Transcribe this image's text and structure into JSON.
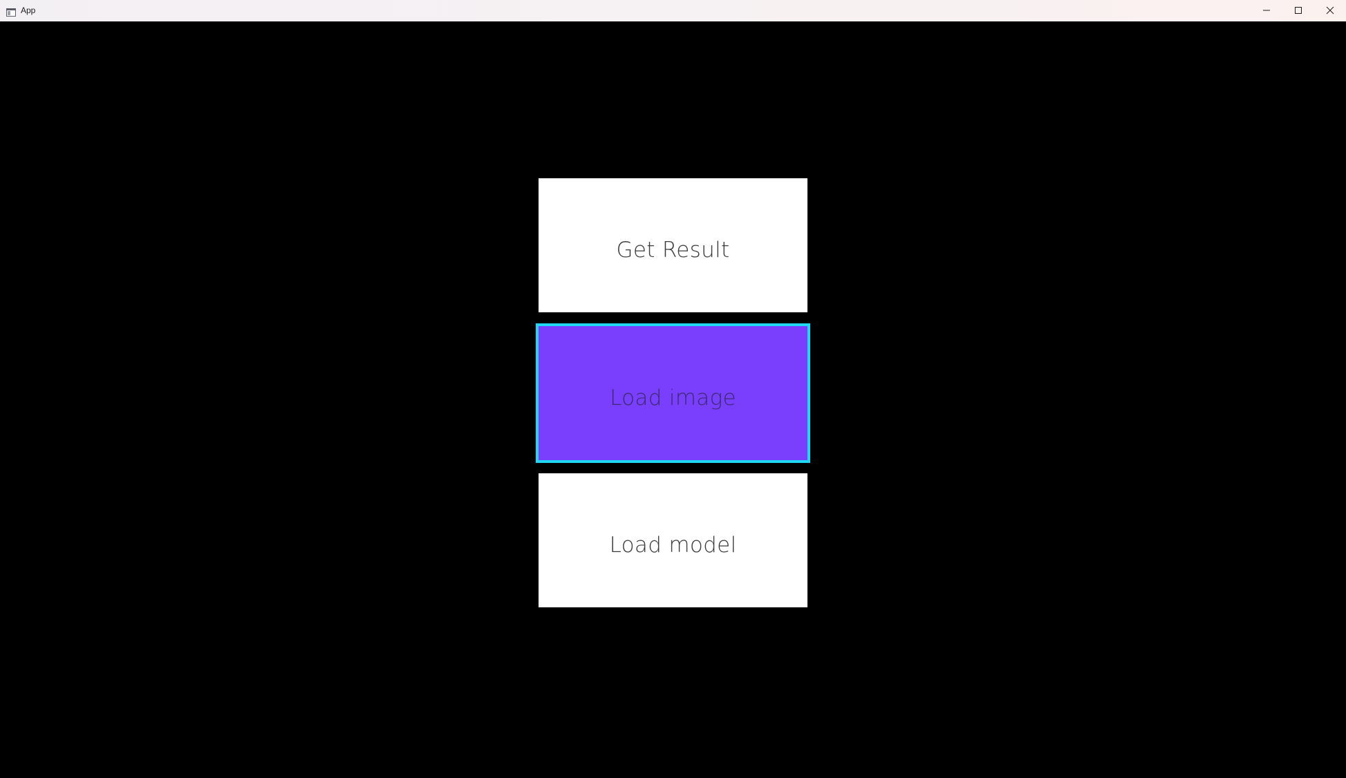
{
  "window": {
    "title": "App",
    "icon": "app-window-icon",
    "controls": {
      "minimize_icon": "minimize-icon",
      "maximize_icon": "maximize-icon",
      "close_icon": "close-icon"
    }
  },
  "main": {
    "buttons": [
      {
        "label": "Get Result",
        "state": "normal"
      },
      {
        "label": "Load image",
        "state": "focused"
      },
      {
        "label": "Load model",
        "state": "normal"
      }
    ]
  },
  "colors": {
    "background": "#000000",
    "button_normal": "#ffffff",
    "button_focused": "#7a3ffc",
    "focus_border": "#1ed7f2"
  }
}
